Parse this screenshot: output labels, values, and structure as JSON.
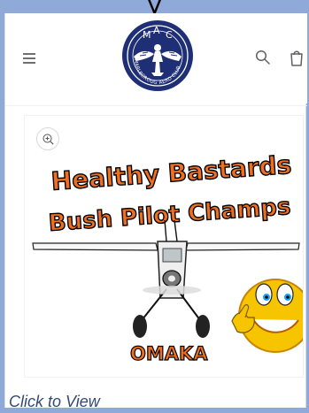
{
  "header": {
    "top_text": "y",
    "logo_text": {
      "top": "MAC",
      "left_arc": "MARLBOROUGH",
      "right_arc": "AERO CLUB"
    },
    "icons": {
      "menu": "hamburger-icon",
      "search": "search-icon",
      "cart": "cart-icon",
      "zoom": "zoom-icon"
    }
  },
  "poster": {
    "title_line_1": "Healthy Bastards",
    "title_line_2": "Bush Pilot Champs",
    "location": "OMAKA"
  },
  "caption": {
    "label": "Click to View"
  },
  "colors": {
    "background": "#8fa9d8",
    "caption": "#304a7a",
    "poster_orange": "#ef6f1f",
    "emoji_yellow": "#f7c400"
  }
}
